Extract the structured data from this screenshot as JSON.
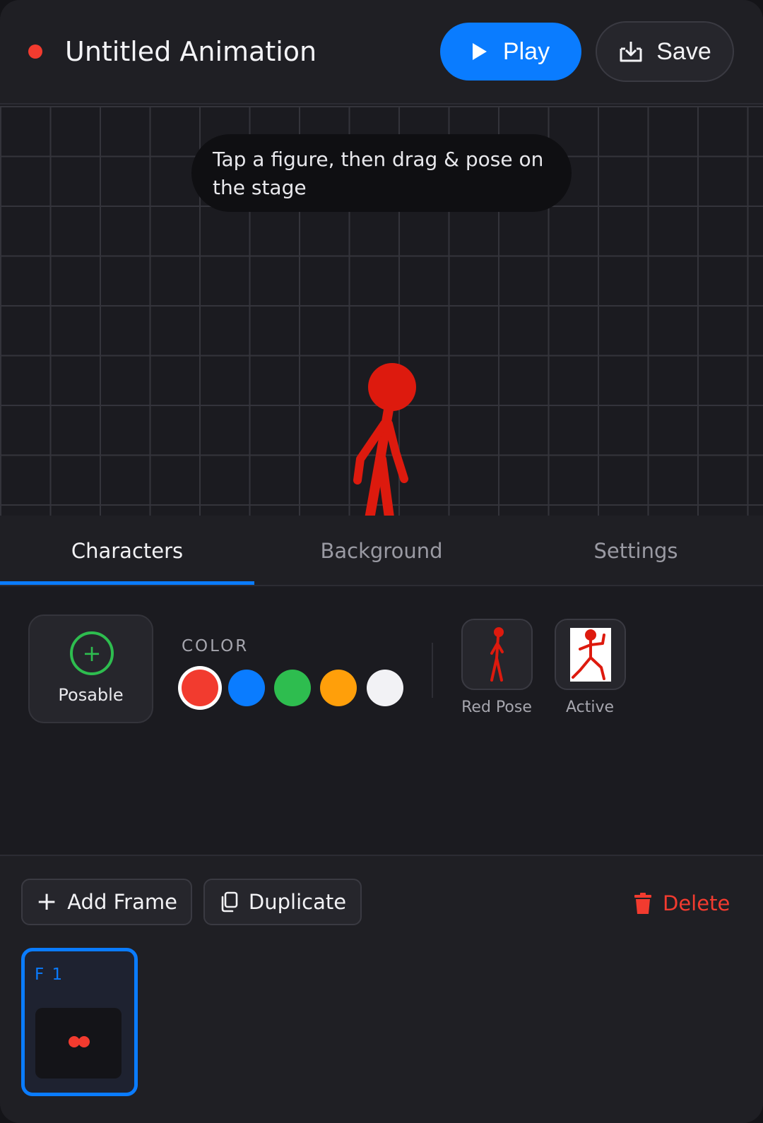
{
  "header": {
    "title": "Untitled Animation",
    "play_label": "Play",
    "save_label": "Save",
    "record_color": "#f23b2f"
  },
  "stage": {
    "hint": "Tap a figure, then drag & pose on the stage",
    "figure_color": "#dd1a0e"
  },
  "tabs": [
    {
      "label": "Characters",
      "active": true
    },
    {
      "label": "Background",
      "active": false
    },
    {
      "label": "Settings",
      "active": false
    }
  ],
  "characters": {
    "posable_label": "Posable",
    "color_label": "COLOR",
    "colors": [
      "#f23b2f",
      "#0a7cff",
      "#2ebd4f",
      "#ff9f0a",
      "#f2f2f5"
    ],
    "selected_color": "#f23b2f",
    "poses": [
      {
        "label": "Red Pose",
        "icon": "red-stick-figure-icon"
      },
      {
        "label": "Active",
        "icon": "active-stick-figure-icon"
      }
    ]
  },
  "frames": {
    "add_label": "Add Frame",
    "duplicate_label": "Duplicate",
    "delete_label": "Delete",
    "items": [
      {
        "label": "F 1",
        "selected": true
      }
    ]
  },
  "accent_color": "#0a7cff"
}
